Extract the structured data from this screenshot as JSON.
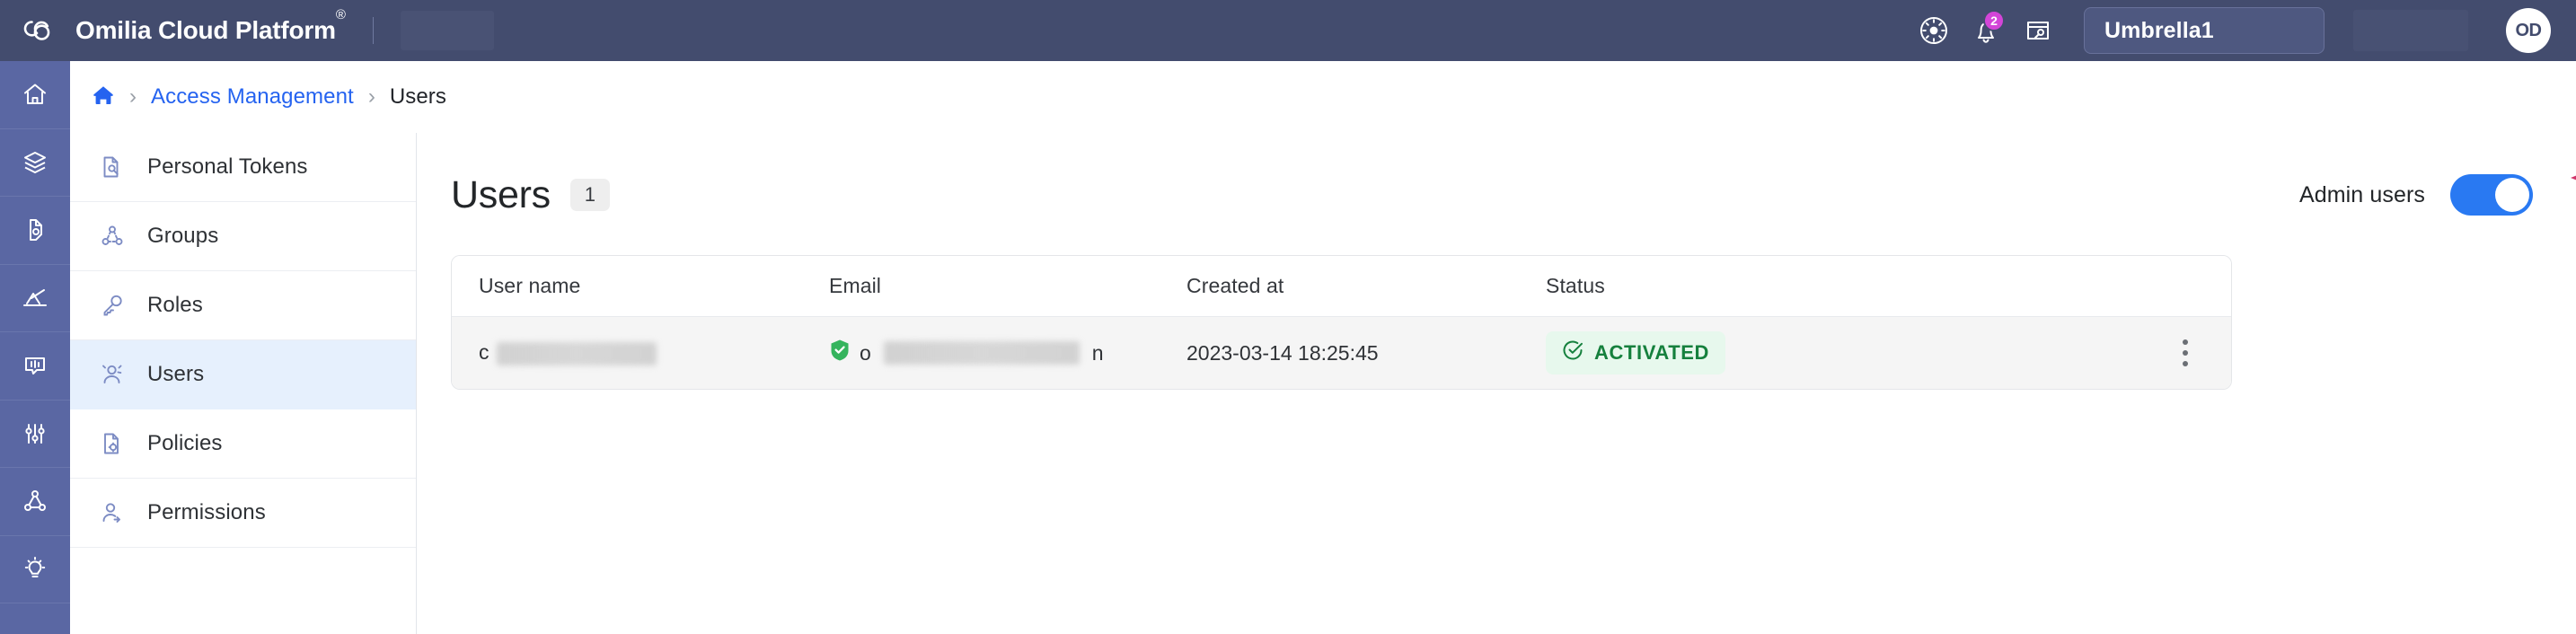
{
  "header": {
    "brand_title": "Omilia Cloud Platform",
    "brand_trademark": "®",
    "logo_icon": "omilia-cloud-logo-icon",
    "theme_icon": "brightness-sun-icon",
    "notifications_icon": "bell-icon",
    "notifications_count": "2",
    "api_key_icon": "card-key-icon",
    "tenant_name": "Umbrella1",
    "avatar_initials": "OD"
  },
  "icon_rail": {
    "items": [
      {
        "icon": "home-icon",
        "name": "rail-item-home"
      },
      {
        "icon": "layers-icon",
        "name": "rail-item-layers"
      },
      {
        "icon": "voice-bot-icon",
        "name": "rail-item-voice-bot"
      },
      {
        "icon": "analytics-chart-icon",
        "name": "rail-item-analytics"
      },
      {
        "icon": "dialog-bubble-icon",
        "name": "rail-item-conversations"
      },
      {
        "icon": "sliders-icon",
        "name": "rail-item-settings"
      },
      {
        "icon": "network-nodes-icon",
        "name": "rail-item-flows"
      },
      {
        "icon": "lightbulb-icon",
        "name": "rail-item-insights"
      }
    ]
  },
  "breadcrumb": {
    "home_icon": "home-icon",
    "separator": "›",
    "link_label": "Access Management",
    "current_label": "Users"
  },
  "sidebar": {
    "items": [
      {
        "label": "Personal Tokens",
        "icon": "document-key-icon",
        "active": false
      },
      {
        "label": "Groups",
        "icon": "groups-nodes-icon",
        "active": false
      },
      {
        "label": "Roles",
        "icon": "key-icon",
        "active": false
      },
      {
        "label": "Users",
        "icon": "users-icon",
        "active": true
      },
      {
        "label": "Policies",
        "icon": "document-gear-icon",
        "active": false
      },
      {
        "label": "Permissions",
        "icon": "user-check-icon",
        "active": false
      }
    ]
  },
  "main": {
    "page_title": "Users",
    "page_count": "1",
    "admin_toggle_label": "Admin users",
    "admin_toggle_state": "on",
    "annotation": "curved-arrow-pointing-at-admin-toggle",
    "annotation_color": "#d1356b",
    "table": {
      "columns": [
        "User name",
        "Email",
        "Created at",
        "Status"
      ],
      "rows": [
        {
          "user_name_prefix": "c",
          "user_name_redacted": true,
          "email_verified_icon": "verified-badge-icon",
          "email_prefix": "o",
          "email_suffix": "n",
          "email_redacted": true,
          "created_at": "2023-03-14 18:25:45",
          "status": "ACTIVATED",
          "status_icon": "check-circle-icon",
          "row_menu_icon": "kebab-menu-icon"
        }
      ]
    }
  },
  "colors": {
    "header_bg": "#434c6e",
    "rail_bg": "#5a67a3",
    "accent_blue": "#2563f0",
    "toggle_on": "#2979f2",
    "nav_active_bg": "#e6f0fd",
    "status_green": "#15803d",
    "status_green_bg": "#e7f8ed",
    "badge_pink": "#d345d8",
    "annotation_pink": "#d1356b"
  }
}
